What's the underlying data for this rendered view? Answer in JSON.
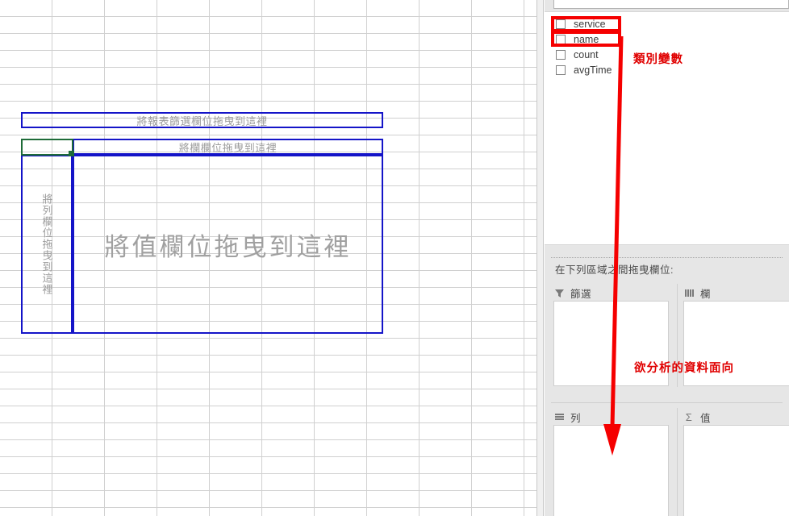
{
  "pivot": {
    "filter_drop": "將報表篩選欄位拖曳到這裡",
    "column_drop": "將欄欄位拖曳到這裡",
    "row_drop": "將列欄位拖曳到這裡",
    "value_drop": "將值欄位拖曳到這裡"
  },
  "pane": {
    "field_list": [
      {
        "label": "service",
        "checked": false
      },
      {
        "label": "name",
        "checked": false
      },
      {
        "label": "count",
        "checked": false
      },
      {
        "label": "avgTime",
        "checked": false
      }
    ],
    "drag_hint": "在下列區域之間拖曳欄位:",
    "zones": [
      {
        "label": "篩選",
        "icon": "filter-icon"
      },
      {
        "label": "欄",
        "icon": "columns-icon"
      },
      {
        "label": "列",
        "icon": "rows-icon"
      },
      {
        "label": "值",
        "icon": "sigma-icon"
      }
    ]
  },
  "annotations": [
    {
      "text": "類別變數"
    },
    {
      "text": "欲分析的資料面向"
    }
  ],
  "colors": {
    "drop_zone_border": "#1414c8",
    "active_cell": "#1e6b38",
    "annotation_red": "#e00000",
    "highlight_red": "#f50000",
    "pane_background": "#e6e6e6"
  }
}
